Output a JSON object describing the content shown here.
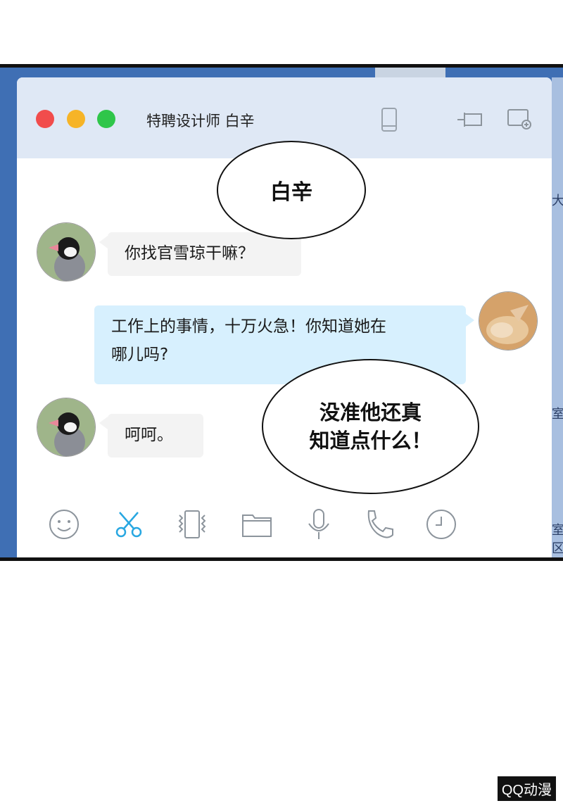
{
  "window": {
    "title": "特聘设计师 白辛",
    "controls": [
      "close-button",
      "minimize-button",
      "zoom-button"
    ],
    "header_icons": [
      "phone-icon",
      "pin-icon",
      "screen-share-icon"
    ]
  },
  "background_chars": [
    "大",
    "室",
    "室区"
  ],
  "messages": [
    {
      "from": "contact",
      "text": "你找官雪琼干嘛？"
    },
    {
      "from": "me",
      "text_line1": "工作上的事情，十万火急！你知道她在",
      "text_line2": "哪儿吗?"
    },
    {
      "from": "contact",
      "text": "呵呵。"
    }
  ],
  "speech_bubbles": {
    "name": "白辛",
    "thought_line1": "没准他还真",
    "thought_line2": "知道点什么！"
  },
  "toolbar": [
    "emoji-icon",
    "scissors-icon",
    "shake-icon",
    "folder-icon",
    "microphone-icon",
    "phone-call-icon",
    "history-clock-icon"
  ],
  "colors": {
    "accent": "#28a7e1",
    "my_bubble": "#d7f0fe",
    "their_bubble": "#f3f3f3",
    "titlebar": "#dfe8f5"
  },
  "watermark": "QQ动漫"
}
